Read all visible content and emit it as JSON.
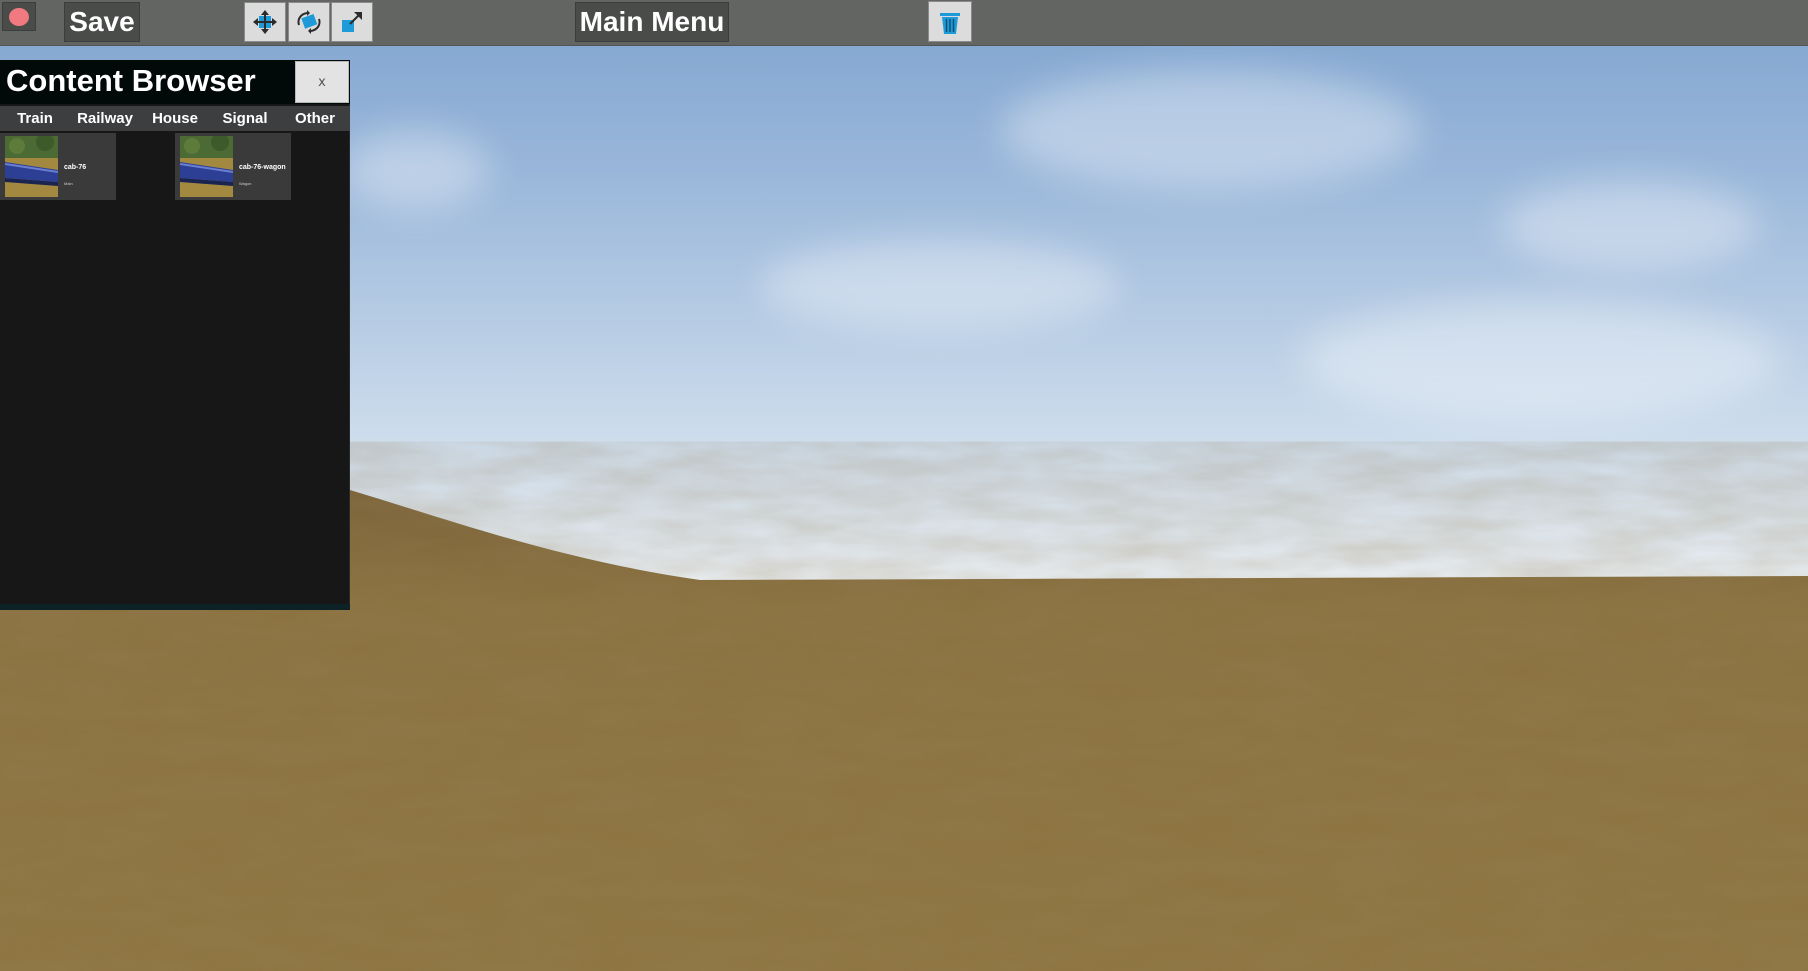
{
  "toolbar": {
    "save_label": "Save",
    "main_menu_label": "Main Menu",
    "record_color": "#f07a7f",
    "tool_accent_color": "#1e9ad8",
    "icons": [
      "record-icon",
      "move-icon",
      "rotate-icon",
      "scale-icon",
      "trash-icon"
    ]
  },
  "content_browser": {
    "title": "Content Browser",
    "close_label": "x",
    "tabs": [
      {
        "label": "Train"
      },
      {
        "label": "Railway"
      },
      {
        "label": "House"
      },
      {
        "label": "Signal"
      },
      {
        "label": "Other"
      }
    ],
    "items": [
      {
        "name": "cab-76",
        "subtitle": "Main"
      },
      {
        "name": "cab-76-wagon",
        "subtitle": "Wagon"
      }
    ]
  },
  "scene": {
    "sky_color": "#9ab7da",
    "ground_color": "#8e7440"
  }
}
